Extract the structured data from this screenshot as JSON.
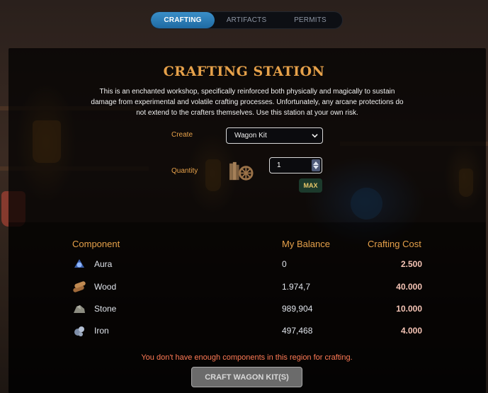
{
  "tabs": [
    {
      "label": "CRAFTING",
      "active": true
    },
    {
      "label": "ARTIFACTS",
      "active": false
    },
    {
      "label": "PERMITS",
      "active": false
    }
  ],
  "station": {
    "title": "CRAFTING STATION",
    "description": "This is an enchanted workshop, specifically reinforced both physically and magically to sustain damage from experimental and volatile crafting processes. Unfortunately, any arcane protections do not extend to the crafters themselves. Use this station at your own risk."
  },
  "form": {
    "create_label": "Create",
    "create_value": "Wagon Kit",
    "quantity_label": "Quantity",
    "quantity_value": "1",
    "max_label": "MAX",
    "item_icon": "wagon-kit-icon"
  },
  "table": {
    "headers": {
      "component": "Component",
      "balance": "My Balance",
      "cost": "Crafting Cost"
    },
    "rows": [
      {
        "name": "Aura",
        "icon": "aura-icon",
        "balance": "0",
        "cost": "2.500"
      },
      {
        "name": "Wood",
        "icon": "wood-icon",
        "balance": "1.974,7",
        "cost": "40.000"
      },
      {
        "name": "Stone",
        "icon": "stone-icon",
        "balance": "989,904",
        "cost": "10.000"
      },
      {
        "name": "Iron",
        "icon": "iron-icon",
        "balance": "497,468",
        "cost": "4.000"
      }
    ]
  },
  "warning": "You don't have enough components in this region for crafting.",
  "craft_button": "CRAFT WAGON KIT(S)",
  "colors": {
    "accent_gold": "#e6a14a",
    "tab_active": "#2a7cb8",
    "warning": "#ff7a55",
    "cost_text": "#f5c4b5",
    "max_button_bg": "#1c3a2c"
  }
}
